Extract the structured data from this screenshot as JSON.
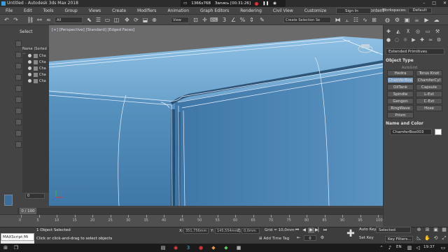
{
  "window": {
    "title": "Untitled - Autodesk 3ds Max 2018"
  },
  "recorder": {
    "resolution": "1366x768",
    "status": "Запись [00:31:26]"
  },
  "menu": [
    "File",
    "Edit",
    "Tools",
    "Group",
    "Views",
    "Create",
    "Modifiers",
    "Animation",
    "Graph Editors",
    "Rendering",
    "Civil View",
    "Customize",
    "Scripting",
    "Content"
  ],
  "signin": "Sign In",
  "workspaces": {
    "label": "Workspaces:",
    "value": "Default"
  },
  "toolbar": {
    "filter": "All",
    "view": "View",
    "selection_set": "Create Selection Se",
    "snap_label": "3"
  },
  "scene_explorer": {
    "tab": "Select",
    "column_header": "Name (Sorted ...",
    "rows": [
      "Cha",
      "Cha",
      "Cha",
      "Cha",
      "Cha"
    ],
    "layer": "0"
  },
  "viewport": {
    "label": "[+] [Perspective] [Standard] [Edged Faces]"
  },
  "command_panel": {
    "category": "Extended Primitives",
    "object_type_title": "Object Type",
    "autogrid": "AutoGrid",
    "buttons": [
      "Hedra",
      "Torus Knot",
      "ChamferBox",
      "ChamferCyl",
      "OilTank",
      "Capsule",
      "Spindle",
      "L-Ext",
      "Gengon",
      "C-Ext",
      "RingWave",
      "Hose",
      "Prism"
    ],
    "name_color_title": "Name and Color",
    "object_name": "ChamferBox003"
  },
  "timeline": {
    "slider": "0 / 100",
    "ticks": [
      "0",
      "5",
      "10",
      "15",
      "20",
      "25",
      "30",
      "35",
      "40",
      "45",
      "50",
      "55",
      "60",
      "65",
      "70",
      "75",
      "80",
      "85",
      "90",
      "95",
      "100"
    ]
  },
  "status": {
    "maxscript": "MAXScript Mi",
    "selection": "1 Object Selected",
    "hint": "Click or click-and-drag to select objects",
    "x_label": "X:",
    "x_value": "351,756mm",
    "y_label": "Y:",
    "y_value": "145,554mm",
    "z_label": "Z:",
    "z_value": "0,0mm",
    "grid": "Grid = 10,0mm",
    "add_time_tag": "Add Time Tag",
    "frame": "0",
    "auto_key": "Auto Key",
    "set_key": "Set Key",
    "selected": "Selected",
    "key_filters": "Key Filters..."
  },
  "taskbar": {
    "language": "EN",
    "clock": "19:37"
  }
}
